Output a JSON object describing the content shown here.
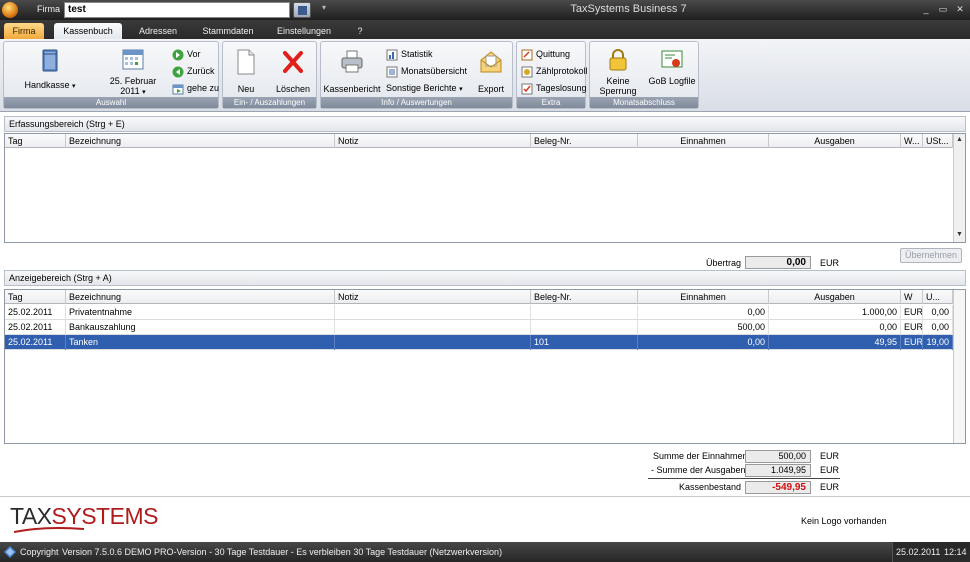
{
  "window": {
    "firma_label": "Firma",
    "firma_value": "test",
    "title": "TaxSystems Business 7",
    "qat_arrow": "▾",
    "min": "_",
    "max": "▭",
    "close": "✕"
  },
  "tabs": [
    "Firma",
    "Kassenbuch",
    "Adressen",
    "Stammdaten",
    "Einstellungen",
    "?"
  ],
  "ribbon": {
    "auswahl": {
      "label": "Auswahl",
      "kasse": "Handkasse",
      "date_line1": "25. Februar",
      "date_line2": "2011",
      "vor": "Vor",
      "zurueck": "Zurück",
      "gehe_zu": "gehe zu"
    },
    "ein_aus": {
      "label": "Ein- / Auszahlungen",
      "neu": "Neu",
      "loeschen": "Löschen"
    },
    "info": {
      "label": "Info / Auswertungen",
      "kassenbericht": "Kassenbericht",
      "statistik": "Statistik",
      "monatsuebersicht": "Monatsübersicht",
      "sonstige": "Sonstige Berichte",
      "export": "Export"
    },
    "extra": {
      "label": "Extra",
      "quittung": "Quittung",
      "zaehlprotokoll": "Zählprotokoll",
      "tageslosung": "Tageslosung"
    },
    "monatsabschluss": {
      "label": "Monatsabschluss",
      "keine_sperrung_1": "Keine",
      "keine_sperrung_2": "Sperrung",
      "gob_logfile": "GoB Logfile"
    }
  },
  "erfassung": {
    "title": "Erfassungsbereich (Strg + E)",
    "columns": [
      "Tag",
      "Bezeichnung",
      "Notiz",
      "Beleg-Nr.",
      "Einnahmen",
      "Ausgaben",
      "W...",
      "USt..."
    ],
    "uebertrag_label": "Übertrag",
    "uebertrag_value": "0,00",
    "currency": "EUR",
    "uebernehmen": "Übernehmen"
  },
  "anzeige": {
    "title": "Anzeigebereich (Strg + A)",
    "columns": [
      "Tag",
      "Bezeichnung",
      "Notiz",
      "Beleg-Nr.",
      "Einnahmen",
      "Ausgaben",
      "W",
      "U..."
    ],
    "rows": [
      [
        "25.02.2011",
        "Privatentnahme",
        "",
        "",
        "0,00",
        "1.000,00",
        "EUR",
        "0,00"
      ],
      [
        "25.02.2011",
        "Bankauszahlung",
        "",
        "",
        "500,00",
        "0,00",
        "EUR",
        "0,00"
      ],
      [
        "25.02.2011",
        "Tanken",
        "",
        "101",
        "0,00",
        "49,95",
        "EUR",
        "19,00"
      ]
    ]
  },
  "summary": {
    "einnahmen_label": "Summe der Einnahmen",
    "einnahmen_value": "500,00",
    "ausgaben_label": "- Summe der Ausgaben",
    "ausgaben_value": "1.049,95",
    "bestand_label": "Kassenbestand",
    "bestand_value": "-549,95",
    "currency": "EUR"
  },
  "branding": {
    "logo_text_1": "TAX",
    "logo_text_2": "SYSTEMS",
    "no_logo": "Kein Logo vorhanden"
  },
  "status": {
    "copyright": "Copyright",
    "version": "Version 7.5.0.6  DEMO PRO-Version - 30 Tage Testdauer - Es verbleiben 30 Tage Testdauer (Netzwerkversion)",
    "date": "25.02.2011",
    "time": "12:14"
  },
  "colors": {
    "accent_orange": "#f2a93b",
    "selection_blue": "#2f5fae",
    "negative_red": "#d01010",
    "logo_red": "#b01c1c"
  }
}
